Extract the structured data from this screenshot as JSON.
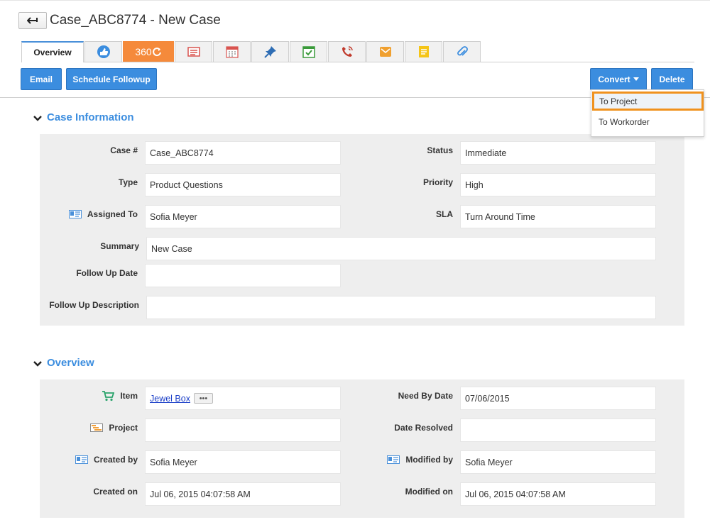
{
  "header": {
    "title": "Case_ABC8774 - New Case"
  },
  "tabs": {
    "overview": "Overview",
    "t360": "360",
    "icons": [
      "like-icon",
      "360-icon",
      "list-icon",
      "calendar-icon",
      "pin-icon",
      "task-icon",
      "call-icon",
      "mail-icon",
      "note-icon",
      "attachment-icon"
    ]
  },
  "actions": {
    "email": "Email",
    "schedule_followup": "Schedule Followup",
    "convert": "Convert",
    "delete": "Delete"
  },
  "convert_menu": {
    "items": [
      "To Project",
      "To Workorder"
    ]
  },
  "case_info": {
    "title": "Case Information",
    "labels": {
      "case_no": "Case #",
      "status": "Status",
      "type": "Type",
      "priority": "Priority",
      "assigned_to": "Assigned To",
      "sla": "SLA",
      "summary": "Summary",
      "follow_up_date": "Follow Up Date",
      "follow_up_description": "Follow Up Description"
    },
    "values": {
      "case_no": "Case_ABC8774",
      "status": "Immediate",
      "type": "Product Questions",
      "priority": "High",
      "assigned_to": "Sofia Meyer",
      "sla": "Turn Around Time",
      "summary": "New Case",
      "follow_up_date": "",
      "follow_up_description": ""
    }
  },
  "overview": {
    "title": "Overview",
    "labels": {
      "item": "Item",
      "need_by_date": "Need By Date",
      "project": "Project",
      "date_resolved": "Date Resolved",
      "created_by": "Created by",
      "modified_by": "Modified by",
      "created_on": "Created on",
      "modified_on": "Modified on"
    },
    "values": {
      "item": "Jewel Box",
      "item_more": "•••",
      "need_by_date": "07/06/2015",
      "project": "",
      "date_resolved": "",
      "created_by": "Sofia Meyer",
      "modified_by": "Sofia Meyer",
      "created_on": "Jul 06, 2015 04:07:58 AM",
      "modified_on": "Jul 06, 2015 04:07:58 AM"
    }
  },
  "colors": {
    "accent": "#3b8ddf",
    "tab360": "#f58a3b",
    "highlight": "#f0921e",
    "panel": "#eeeeee"
  }
}
